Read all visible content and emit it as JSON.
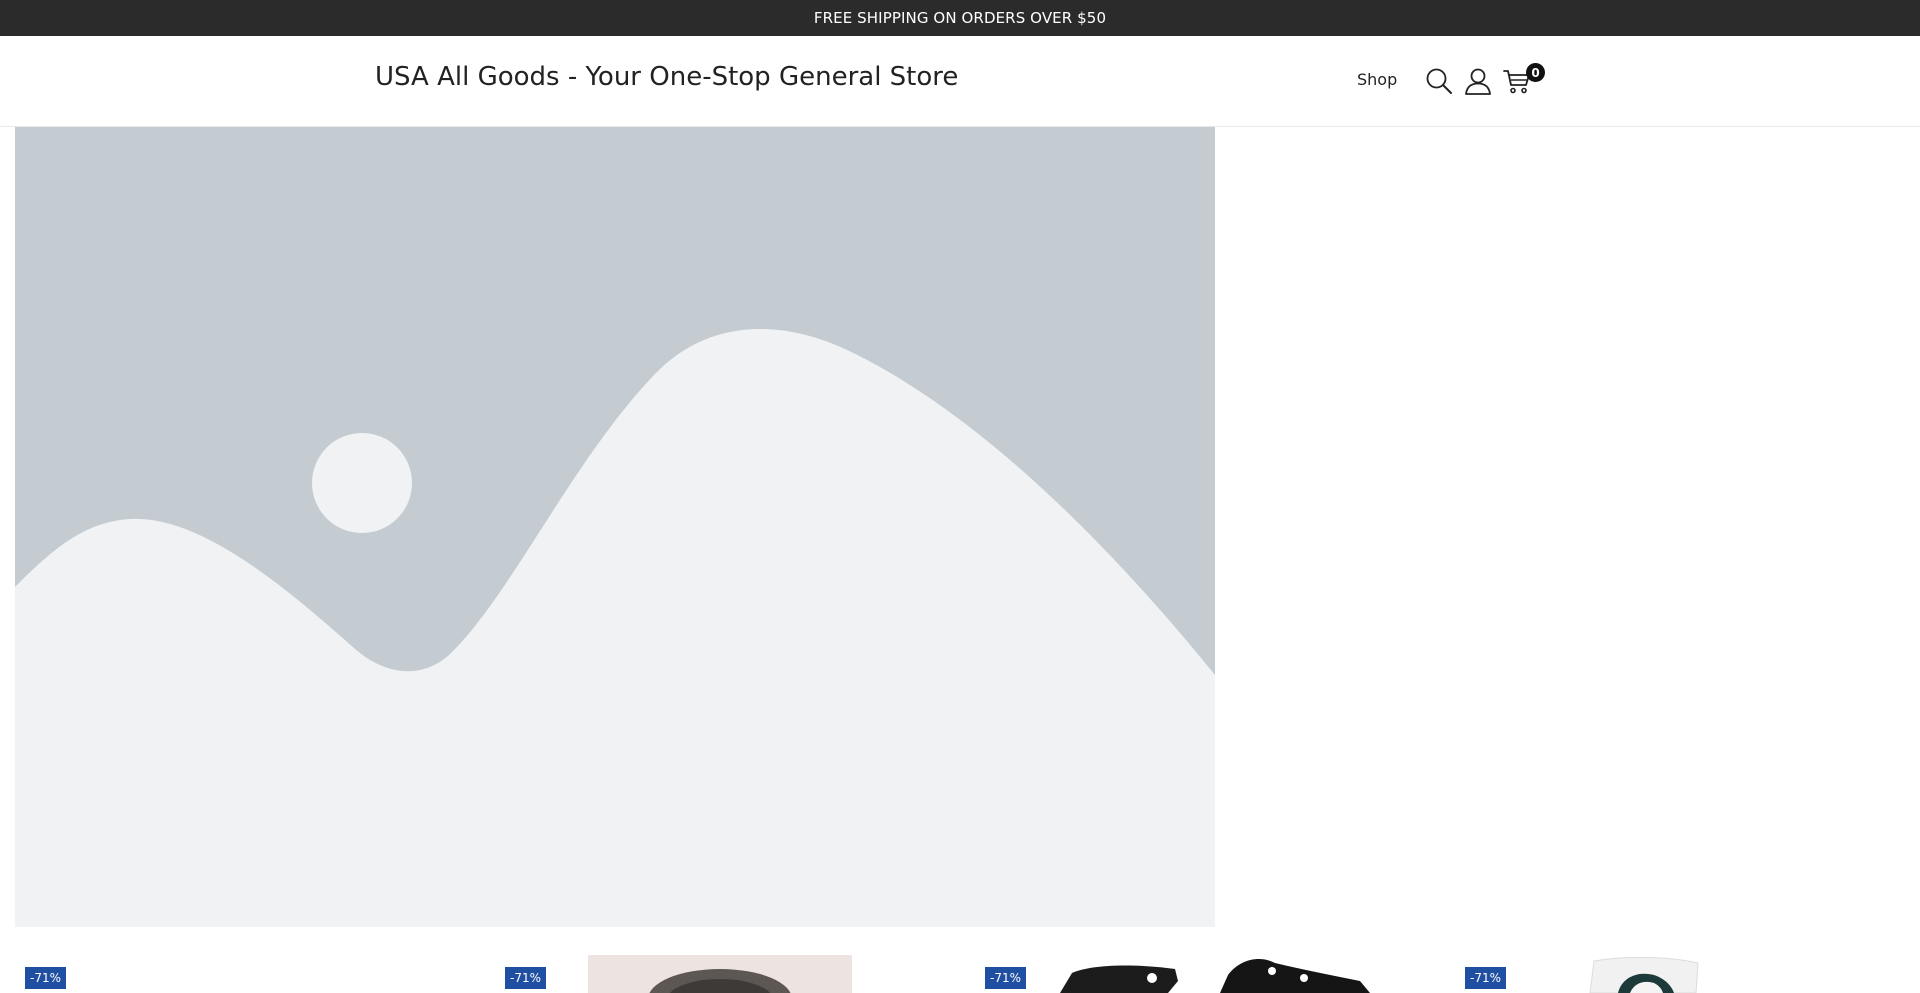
{
  "announcement": {
    "text": "FREE SHIPPING ON ORDERS OVER $50"
  },
  "header": {
    "site_title": "USA All Goods - Your One-Stop General Store",
    "nav": [
      {
        "label": "Shop"
      }
    ],
    "icons": {
      "search": "search-icon",
      "account": "user-icon",
      "cart": "cart-icon"
    },
    "cart_count": "0"
  },
  "hero": {
    "image": "placeholder-image",
    "colors": {
      "sky": "#c4ccd2",
      "hills": "#f0f2f3"
    }
  },
  "products": [
    {
      "badge": "-71%"
    },
    {
      "badge": "-71%"
    },
    {
      "badge": "-71%"
    },
    {
      "badge": "-71%"
    }
  ],
  "colors": {
    "announcement_bg": "#2b2b2b",
    "badge_bg": "#1f4fa3"
  }
}
